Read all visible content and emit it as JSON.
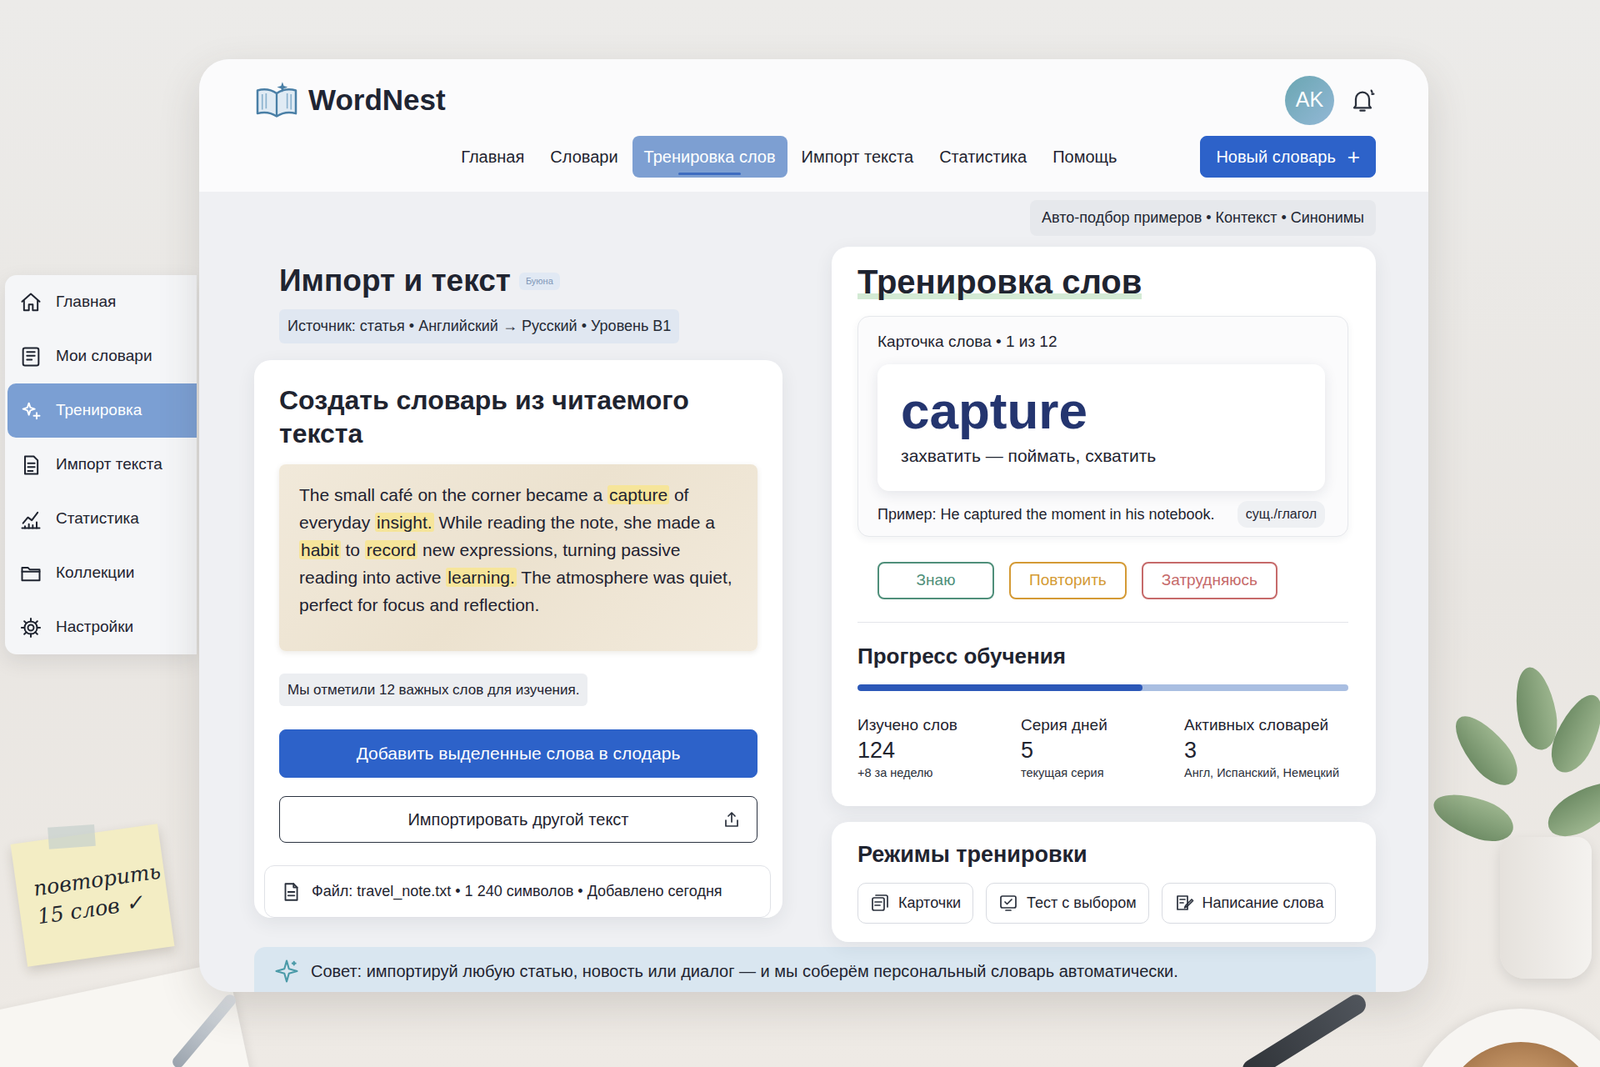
{
  "app": {
    "name": "WordNest",
    "avatar": "AK"
  },
  "top_nav": [
    {
      "label": "Главная",
      "selected": false
    },
    {
      "label": "Словари",
      "selected": false
    },
    {
      "label": "Тренировка слов",
      "selected": true
    },
    {
      "label": "Импорт текста",
      "selected": false
    },
    {
      "label": "Статистика",
      "selected": false
    },
    {
      "label": "Помощь",
      "selected": false
    }
  ],
  "new_dictionary": {
    "label": "Новый словарь",
    "icon": "+"
  },
  "features": "Авто-подбор примеров • Контекст • Синонимы",
  "sidebar": {
    "items": [
      {
        "label": "Главная",
        "selected": false
      },
      {
        "label": "Мои словари",
        "selected": false
      },
      {
        "label": "Тренировка",
        "selected": true
      },
      {
        "label": "Импорт текста",
        "selected": false
      },
      {
        "label": "Статистика",
        "selected": false
      },
      {
        "label": "Коллекции",
        "selected": false
      },
      {
        "label": "Настройки",
        "selected": false
      }
    ]
  },
  "import": {
    "title": "Импорт и текст",
    "badge": "Буюна",
    "source": "Источник: статья • Английский → Русский • Уровень B1",
    "card_title": "Создать словарь из читаемого текста",
    "text": [
      {
        "text": "The small café on the corner became a ",
        "highlighted": false
      },
      {
        "text": "capture",
        "highlighted": true
      },
      {
        "text": " of everyday ",
        "highlighted": false
      },
      {
        "text": "insight.",
        "highlighted": true
      },
      {
        "text": " While reading the note, she made a ",
        "highlighted": false
      },
      {
        "text": "habit",
        "highlighted": true
      },
      {
        "text": " to ",
        "highlighted": false
      },
      {
        "text": "record",
        "highlighted": true
      },
      {
        "text": " new expressions, turning passive reading into active ",
        "highlighted": false
      },
      {
        "text": "learning.",
        "highlighted": true
      },
      {
        "text": " The atmosphere was quiet, perfect for focus and reflection.",
        "highlighted": false
      }
    ],
    "marked_note": "Мы отметили 12 важных слов для изучения.",
    "add_button": "Добавить выделенные слова в слодарь",
    "import_button": "Импортировать другой текст",
    "file": "Файл: travel_note.txt • 1 240 символов • Добавлено сегодня"
  },
  "training": {
    "title": "Тренировка слов",
    "card_label": "Карточка слова • 1 из 12",
    "word": "capture",
    "translation": "захватить — поймать, схватить",
    "example": "Пример: He captured the moment in his notebook.",
    "part_of_speech": "сущ./глагол",
    "answers": [
      {
        "label": "Знаю",
        "color": "#4f8f7a"
      },
      {
        "label": "Повторить",
        "color": "#d49a35"
      },
      {
        "label": "Затрудняюсь",
        "color": "#c66a6a"
      }
    ]
  },
  "progress": {
    "title": "Прогресс обучения",
    "level": 0.58,
    "stats": [
      {
        "label": "Изучено слов",
        "value": "124",
        "note": "+8 за неделю"
      },
      {
        "label": "Серия дней",
        "value": "5",
        "note": "текущая серия"
      },
      {
        "label": "Активных словарей",
        "value": "3",
        "note": "Англ, Испанский, Немецкий"
      }
    ]
  },
  "modes": {
    "title": "Режимы тренировки",
    "items": [
      "Карточки",
      "Тест с выбором",
      "Написание слова"
    ]
  },
  "tip": "Совет: импортируй любую статью, новость или диалог — и мы соберём персональный словарь автоматически.",
  "sticky_note": {
    "lines": [
      "повторить",
      "15 слов ✓"
    ]
  }
}
